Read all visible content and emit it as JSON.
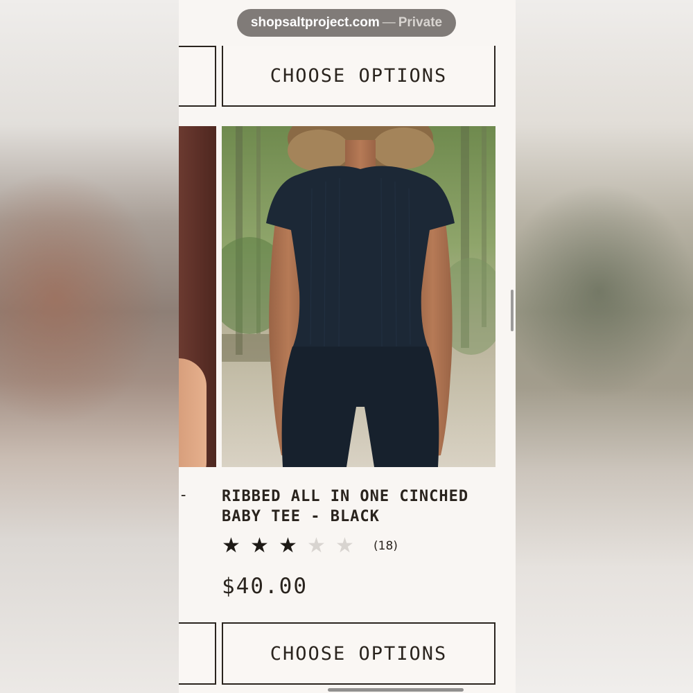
{
  "browser": {
    "domain": "shopsaltproject.com",
    "separator": "—",
    "mode": "Private"
  },
  "product_card_top": {
    "button_label": "CHOOSE OPTIONS"
  },
  "product": {
    "prev_title_fragment": "-",
    "title": "RIBBED ALL IN ONE CINCHED BABY TEE - BLACK",
    "rating": 3,
    "rating_max": 5,
    "review_count": "(18)",
    "price": "$40.00",
    "button_label": "CHOOSE OPTIONS",
    "image_alt": "model wearing black ribbed baby tee and black leggings outdoors"
  },
  "icons": {
    "star_filled": "star-filled-icon",
    "star_empty": "star-empty-icon"
  },
  "colors": {
    "text": "#2a241e",
    "background": "#f9f6f3",
    "star_filled": "#1e1a16",
    "star_empty": "#d8d4d0"
  }
}
